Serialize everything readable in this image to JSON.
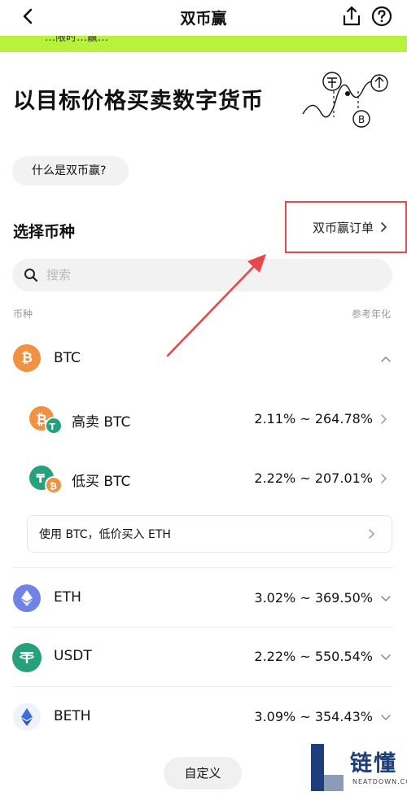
{
  "nav": {
    "title": "双币赢"
  },
  "banner": {
    "text": "…限时…赢…"
  },
  "hero": {
    "title": "以目标价格买卖数字货币"
  },
  "intro_button": "什么是双币赢?",
  "section": {
    "title": "选择币种",
    "orders_link": "双币赢订单"
  },
  "search": {
    "placeholder": "搜索"
  },
  "columns": {
    "left": "币种",
    "right": "参考年化"
  },
  "coins": [
    {
      "name": "BTC",
      "rate": "",
      "icon": "btc-icon",
      "color": "#f09242",
      "expanded": true
    },
    {
      "name": "ETH",
      "rate": "3.02% ~ 369.50%",
      "icon": "eth-icon",
      "color": "#6f82e6"
    },
    {
      "name": "USDT",
      "rate": "2.22% ~ 550.54%",
      "icon": "usdt-icon",
      "color": "#26a17b"
    },
    {
      "name": "BETH",
      "rate": "3.09% ~ 354.43%",
      "icon": "beth-icon",
      "color": "#3b6fd9"
    }
  ],
  "btc_products": [
    {
      "name": "高卖 BTC",
      "rate": "2.11% ~ 264.78%"
    },
    {
      "name": "低买 BTC",
      "rate": "2.22% ~ 207.01%"
    }
  ],
  "btc_card": {
    "text": "使用 BTC，低价买入 ETH"
  },
  "custom_button": "自定义",
  "watermark": {
    "text": "链懂",
    "sub": "NEATDOWN.COM"
  },
  "colors": {
    "accent_green": "#b9f23a",
    "highlight_red": "#e8474f"
  }
}
